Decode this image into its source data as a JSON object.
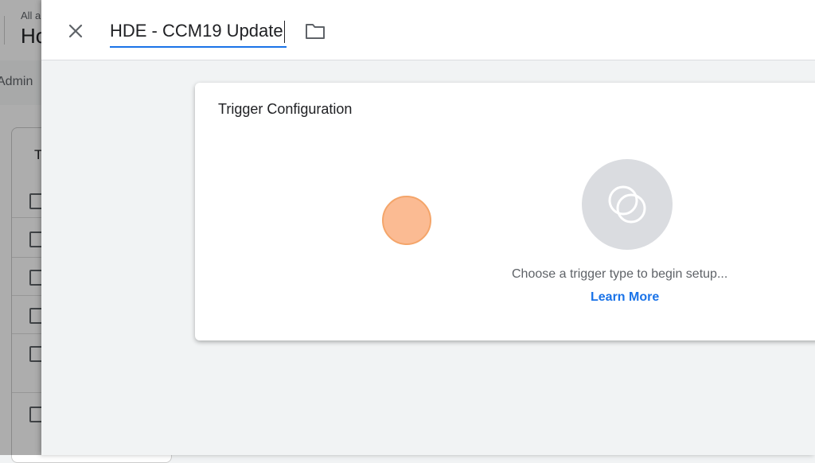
{
  "background": {
    "breadcrumb": "All a",
    "title": "Ho",
    "nav_admin": "Admin",
    "card_heading": "T"
  },
  "sheet": {
    "close_icon": "close-icon",
    "name_value": "HDE - CCM19 Update",
    "folder_icon": "folder-icon"
  },
  "trigger": {
    "section_title": "Trigger Configuration",
    "trigger_icon": "trigger-icon",
    "hint_text": "Choose a trigger type to begin setup...",
    "learn_more": "Learn More"
  },
  "colors": {
    "accent": "#1a73e8",
    "click_indicator": "#f4a56a"
  }
}
